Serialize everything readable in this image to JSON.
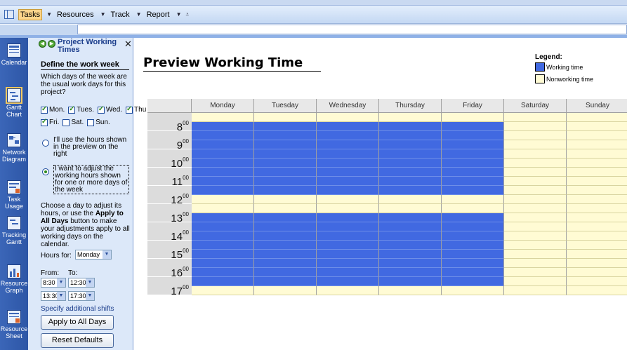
{
  "toolbar": {
    "items": [
      {
        "label": "Tasks",
        "active": true
      },
      {
        "label": "Resources",
        "active": false
      },
      {
        "label": "Track",
        "active": false
      },
      {
        "label": "Report",
        "active": false
      }
    ]
  },
  "viewbar": {
    "items": [
      {
        "label": "Calendar",
        "icon": "calendar-icon"
      },
      {
        "label": "Gantt Chart",
        "icon": "gantt-chart-icon"
      },
      {
        "label": "Network Diagram",
        "icon": "network-diagram-icon"
      },
      {
        "label": "Task Usage",
        "icon": "task-usage-icon"
      },
      {
        "label": "Tracking Gantt",
        "icon": "tracking-gantt-icon"
      },
      {
        "label": "Resource Graph",
        "icon": "resource-graph-icon"
      },
      {
        "label": "Resource Sheet",
        "icon": "resource-sheet-icon"
      }
    ]
  },
  "pane": {
    "title": "Project Working Times",
    "section_title": "Define the work week",
    "question": "Which days of the week are the usual work days for this project?",
    "days": [
      {
        "label": "Mon.",
        "checked": true
      },
      {
        "label": "Tues.",
        "checked": true
      },
      {
        "label": "Wed.",
        "checked": true
      },
      {
        "label": "Thu",
        "checked": true
      },
      {
        "label": "Fri.",
        "checked": true
      },
      {
        "label": "Sat.",
        "checked": false
      },
      {
        "label": "Sun.",
        "checked": false
      }
    ],
    "option1": "I'll use the hours shown in the preview on the right",
    "option2": "I want to adjust the working hours shown for one or more days of the week",
    "instructions_pre": "Choose a day to adjust its hours, or use the ",
    "instructions_bold": "Apply to All Days",
    "instructions_post": " button to make your adjustments apply to all working days on the calendar.",
    "hours_for_label": "Hours for:",
    "hours_for_value": "Monday",
    "from_label": "From:",
    "to_label": "To:",
    "shift1_from": "8:30",
    "shift1_to": "12:30",
    "shift2_from": "13:30",
    "shift2_to": "17:30",
    "additional_shifts_link": "Specify additional shifts",
    "apply_button": "Apply to All Days",
    "reset_button": "Reset Defaults"
  },
  "preview": {
    "title": "Preview Working Time",
    "legend_title": "Legend:",
    "legend_working": "Working time",
    "legend_nonworking": "Nonworking time",
    "colors": {
      "working": "#4169e1",
      "nonworking": "#fffbd4"
    },
    "days": [
      "Monday",
      "Tuesday",
      "Wednesday",
      "Thursday",
      "Friday",
      "Saturday",
      "Sunday"
    ],
    "hours": [
      {
        "h": "8",
        "m": "00"
      },
      {
        "h": "9",
        "m": "00"
      },
      {
        "h": "10",
        "m": "00"
      },
      {
        "h": "11",
        "m": "00"
      },
      {
        "h": "12",
        "m": "00"
      },
      {
        "h": "13",
        "m": "00"
      },
      {
        "h": "14",
        "m": "00"
      },
      {
        "h": "15",
        "m": "00"
      },
      {
        "h": "16",
        "m": "00"
      },
      {
        "h": "17",
        "m": "00"
      }
    ],
    "working_days": [
      true,
      true,
      true,
      true,
      true,
      false,
      false
    ],
    "working_half_hours": [
      false,
      true,
      true,
      true,
      true,
      true,
      true,
      true,
      true,
      false,
      false,
      true,
      true,
      true,
      true,
      true,
      true,
      true,
      true,
      false
    ]
  }
}
